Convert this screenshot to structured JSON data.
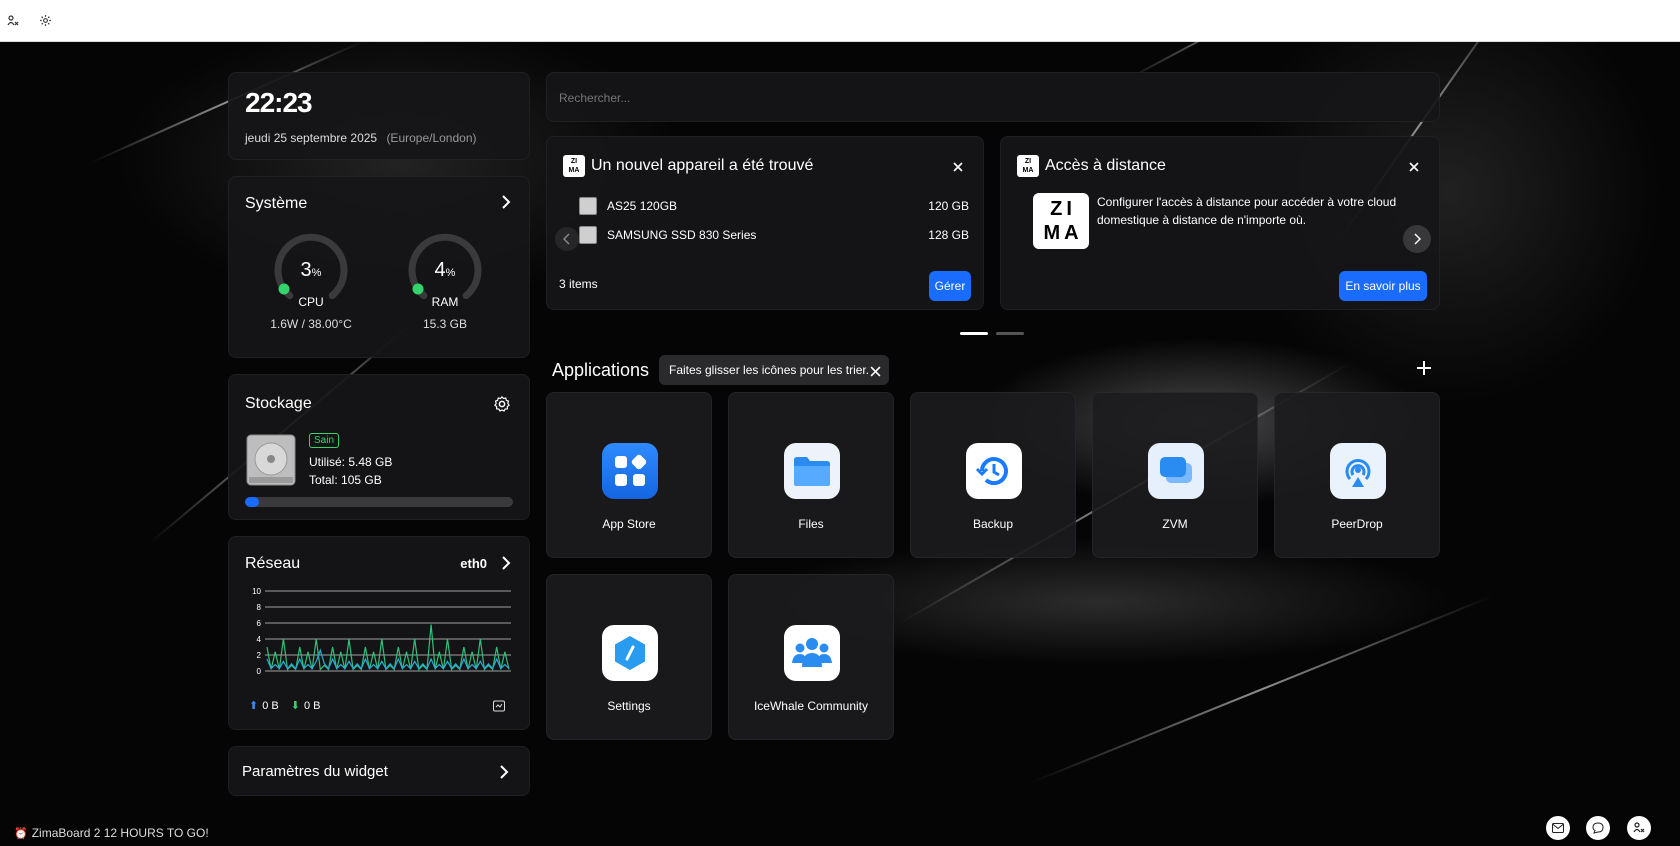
{
  "topbar": {
    "icons": [
      "user-network-icon",
      "gear-icon"
    ]
  },
  "clock": {
    "time": "22:23",
    "date": "jeudi 25 septembre 2025",
    "timezone": "(Europe/London)"
  },
  "search": {
    "placeholder": "Rechercher..."
  },
  "system": {
    "title": "Système",
    "cpu": {
      "value": "3",
      "unit": "%",
      "label": "CPU",
      "detail": "1.6W / 38.00°C",
      "percent": 3
    },
    "ram": {
      "value": "4",
      "unit": "%",
      "label": "RAM",
      "detail": "15.3 GB",
      "percent": 4
    }
  },
  "storage": {
    "title": "Stockage",
    "badge": "Sain",
    "used": "Utilisé: 5.48 GB",
    "total": "Total: 105 GB",
    "used_fraction": 0.052
  },
  "network": {
    "title": "Réseau",
    "interface": "eth0",
    "y_ticks": [
      "10",
      "8",
      "6",
      "4",
      "2",
      "0"
    ],
    "up": "0 B",
    "down": "0 B"
  },
  "widget_settings": {
    "label": "Paramètres du widget"
  },
  "new_device": {
    "title": "Un nouvel appareil a été trouvé",
    "devices": [
      {
        "name": "AS25 120GB",
        "size": "120 GB"
      },
      {
        "name": "SAMSUNG SSD 830 Series",
        "size": "128 GB"
      }
    ],
    "count": "3 items",
    "manage_label": "Gérer"
  },
  "remote_access": {
    "title": "Accès à distance",
    "description": "Configurer l'accès à distance pour accéder à votre cloud domestique à distance de n'importe où.",
    "learn_more_label": "En savoir plus",
    "logo_text": "ZI MA"
  },
  "applications": {
    "title": "Applications",
    "tip": "Faites glisser les icônes pour les trier.",
    "apps": [
      {
        "label": "App Store"
      },
      {
        "label": "Files"
      },
      {
        "label": "Backup"
      },
      {
        "label": "ZVM"
      },
      {
        "label": "PeerDrop"
      },
      {
        "label": "Settings"
      },
      {
        "label": "IceWhale Community"
      }
    ]
  },
  "footer": {
    "promo": "ZimaBoard 2 12 HOURS TO GO!"
  }
}
